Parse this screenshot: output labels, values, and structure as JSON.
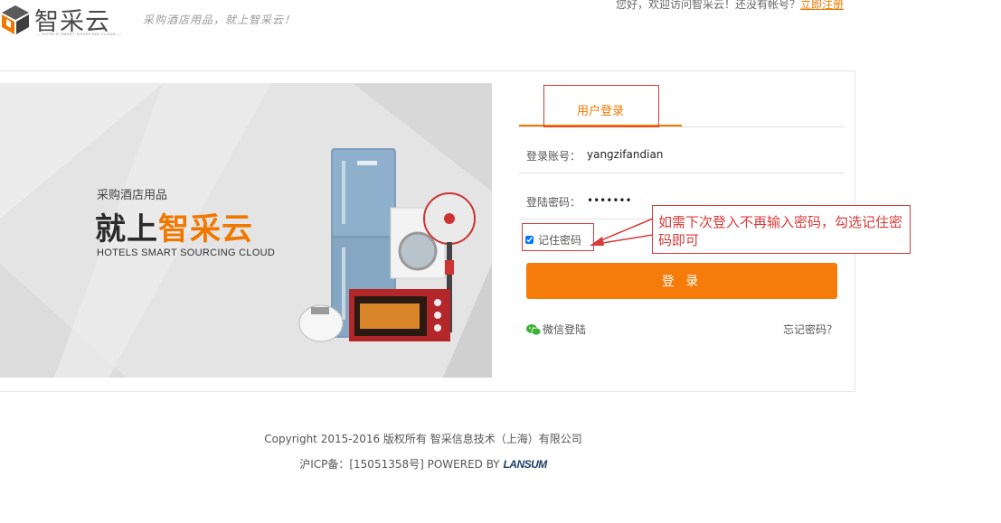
{
  "header": {
    "logo_text": "智采云",
    "logo_subtext": "— HOTELS SMART SOURCING CLOUD —",
    "slogan": "采购酒店用品，就上智采云！",
    "welcome_text": "您好，欢迎访问智采云！还没有帐号？",
    "register_link": "立即注册"
  },
  "banner": {
    "small_text": "采购酒店用品",
    "big_text_prefix": "就上",
    "big_text_accent": "智采云",
    "english_text": "HOTELS SMART SOURCING CLOUD"
  },
  "login": {
    "tab_label": "用户登录",
    "account_label": "登录账号：",
    "account_value": "yangzifandian",
    "password_label": "登陆密码：",
    "password_value": "•••••••",
    "remember_label": "记住密码",
    "remember_checked": true,
    "submit_label": "登 录",
    "wechat_label": "微信登陆",
    "forgot_label": "忘记密码？"
  },
  "annotation": {
    "note": "如需下次登入不再输入密码，勾选记住密码即可"
  },
  "footer": {
    "copyright": "Copyright 2015-2016 版权所有 智采信息技术（上海）有限公司",
    "icp_prefix": "沪ICP备：[15051358号] POWERED BY ",
    "powered_brand": "LANSUM"
  },
  "colors": {
    "accent": "#f57b0a",
    "annotation": "#d93a3a"
  }
}
